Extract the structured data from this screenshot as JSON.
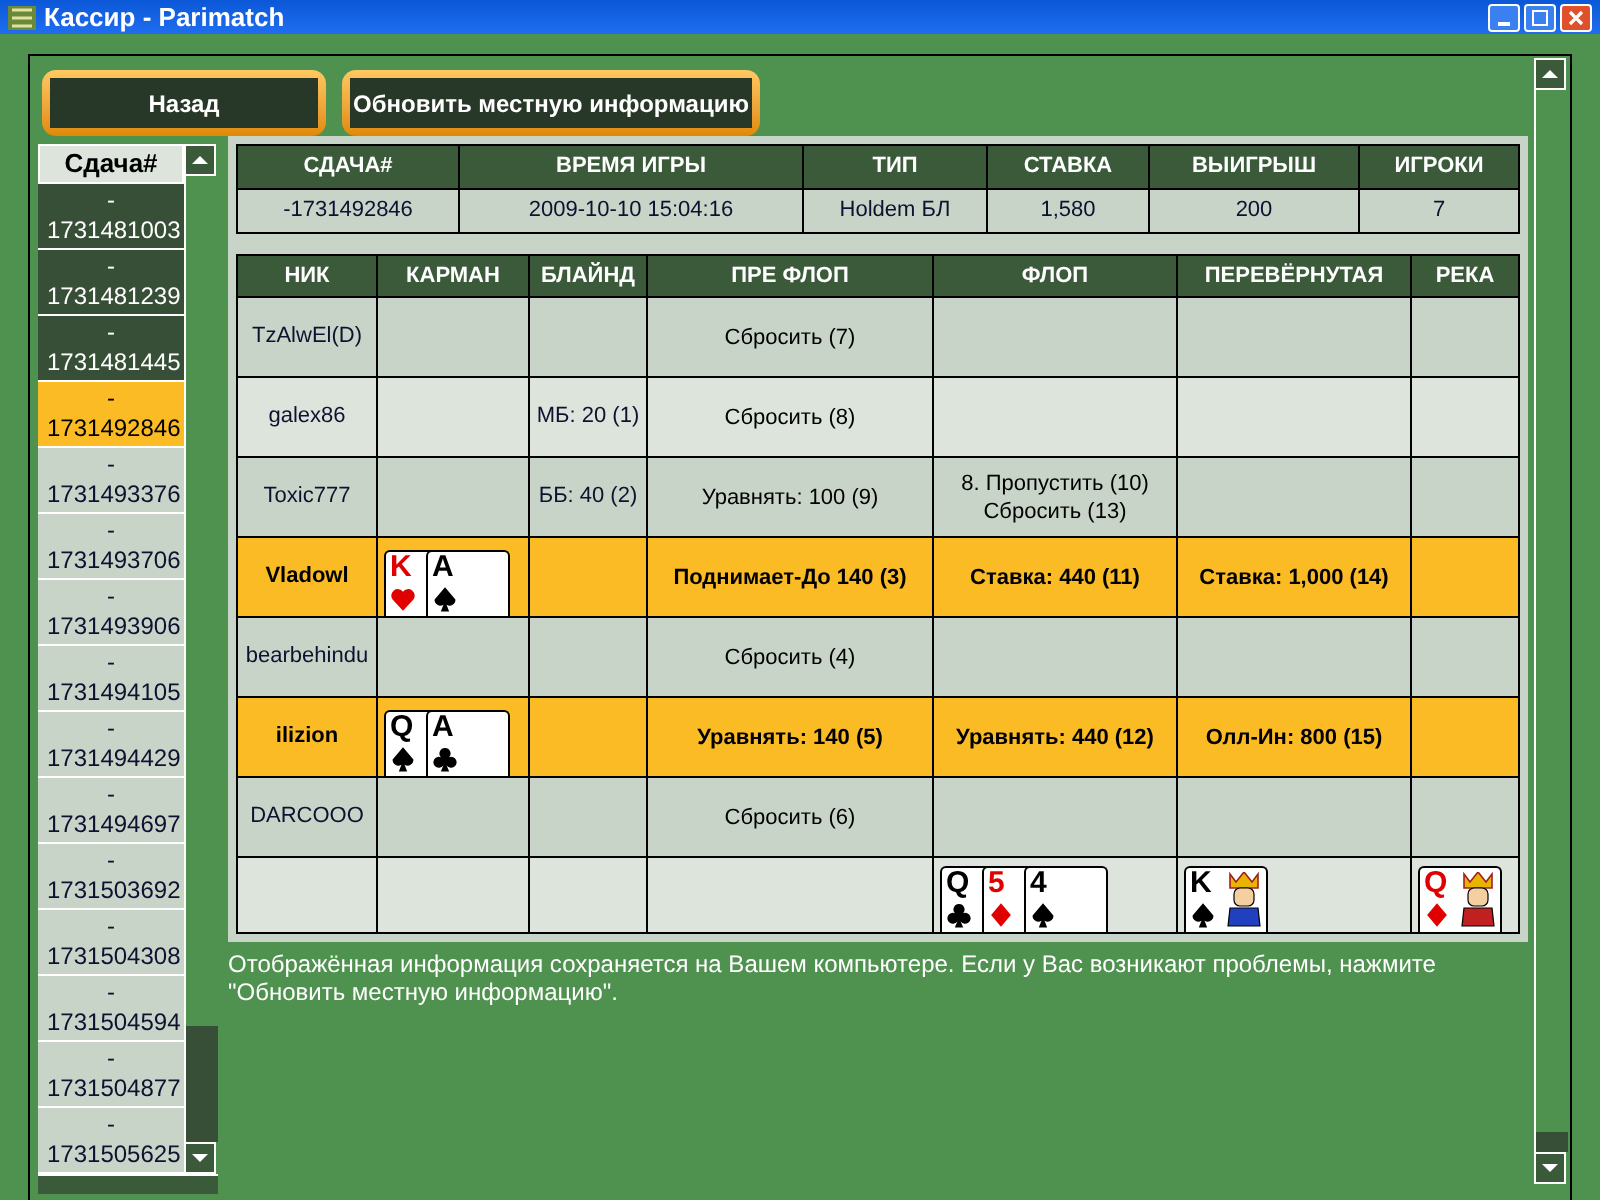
{
  "window": {
    "title": "Кассир - Parimatch"
  },
  "buttons": [
    {
      "label": "Назад"
    },
    {
      "label": "Обновить местную информацию"
    }
  ],
  "hand_list": {
    "header": "Сдача#",
    "items": [
      {
        "label": "-1731481003",
        "selected": false,
        "viewed": true
      },
      {
        "label": "-1731481239",
        "selected": false,
        "viewed": true
      },
      {
        "label": "-1731481445",
        "selected": false,
        "viewed": true
      },
      {
        "label": "-1731492846",
        "selected": true,
        "viewed": false
      },
      {
        "label": "-1731493376",
        "selected": false,
        "viewed": false
      },
      {
        "label": "-1731493706",
        "selected": false,
        "viewed": false
      },
      {
        "label": "-1731493906",
        "selected": false,
        "viewed": false
      },
      {
        "label": "-1731494105",
        "selected": false,
        "viewed": false
      },
      {
        "label": "-1731494429",
        "selected": false,
        "viewed": false
      },
      {
        "label": "-1731494697",
        "selected": false,
        "viewed": false
      },
      {
        "label": "-1731503692",
        "selected": false,
        "viewed": false
      },
      {
        "label": "-1731504308",
        "selected": false,
        "viewed": false
      },
      {
        "label": "-1731504594",
        "selected": false,
        "viewed": false
      },
      {
        "label": "-1731504877",
        "selected": false,
        "viewed": false
      },
      {
        "label": "-1731505625",
        "selected": false,
        "viewed": false
      }
    ]
  },
  "summary": {
    "columns": [
      "СДАЧА#",
      "ВРЕМЯ ИГРЫ",
      "ТИП",
      "СТАВКА",
      "ВЫИГРЫШ",
      "ИГРОКИ"
    ],
    "values": [
      "-1731492846",
      "2009-10-10 15:04:16",
      "Holdem БЛ",
      "1,580",
      "200",
      "7"
    ]
  },
  "players": {
    "columns": [
      "НИК",
      "КАРМАН",
      "БЛАЙНД",
      "ПРЕ ФЛОП",
      "ФЛОП",
      "ПЕРЕВЁРНУТАЯ",
      "РЕКА"
    ],
    "rows": [
      {
        "nick": "TzAlwEl(D)",
        "highlighted": false,
        "preflop": [
          "Сбросить (7)"
        ]
      },
      {
        "nick": "galex86",
        "highlighted": false,
        "blind": "МБ: 20 (1)",
        "preflop": [
          "Сбросить (8)"
        ]
      },
      {
        "nick": "Toxic777",
        "highlighted": false,
        "blind": "ББ: 40 (2)",
        "preflop": [
          "Уравнять: 100 (9)"
        ],
        "flop": [
          "8. Пропустить (10)",
          "Сбросить (13)"
        ]
      },
      {
        "nick": "Vladowl",
        "highlighted": true,
        "pocket": [
          {
            "rank": "K",
            "kind": "hearts"
          },
          {
            "rank": "A",
            "kind": "spades"
          }
        ],
        "preflop": [
          "Поднимает-До 140 (3)"
        ],
        "flop": [
          "Ставка: 440 (11)"
        ],
        "turn": [
          "Ставка: 1,000 (14)"
        ]
      },
      {
        "nick": "bearbehindu",
        "highlighted": false,
        "preflop": [
          "Сбросить (4)"
        ]
      },
      {
        "nick": "ilizion",
        "highlighted": true,
        "pocket": [
          {
            "rank": "Q",
            "kind": "spades"
          },
          {
            "rank": "A",
            "kind": "clubs"
          }
        ],
        "preflop": [
          "Уравнять: 140 (5)"
        ],
        "flop": [
          "Уравнять: 440 (12)"
        ],
        "turn": [
          "Олл-Ин: 800 (15)"
        ]
      },
      {
        "nick": "DARCOOO",
        "highlighted": false,
        "preflop": [
          "Сбросить (6)"
        ]
      }
    ],
    "board": {
      "flop": [
        {
          "rank": "Q",
          "kind": "clubs"
        },
        {
          "rank": "5",
          "kind": "diamonds"
        },
        {
          "rank": "4",
          "kind": "spades"
        }
      ],
      "turn": [
        {
          "rank": "K",
          "kind": "spades",
          "court": true
        }
      ],
      "river": [
        {
          "rank": "Q",
          "kind": "diamonds",
          "court": true
        }
      ]
    }
  },
  "note": "Отображённая информация сохраняется на Вашем компьютере. Если у Вас возникают проблемы, нажмите \"Обновить местную информацию\"."
}
